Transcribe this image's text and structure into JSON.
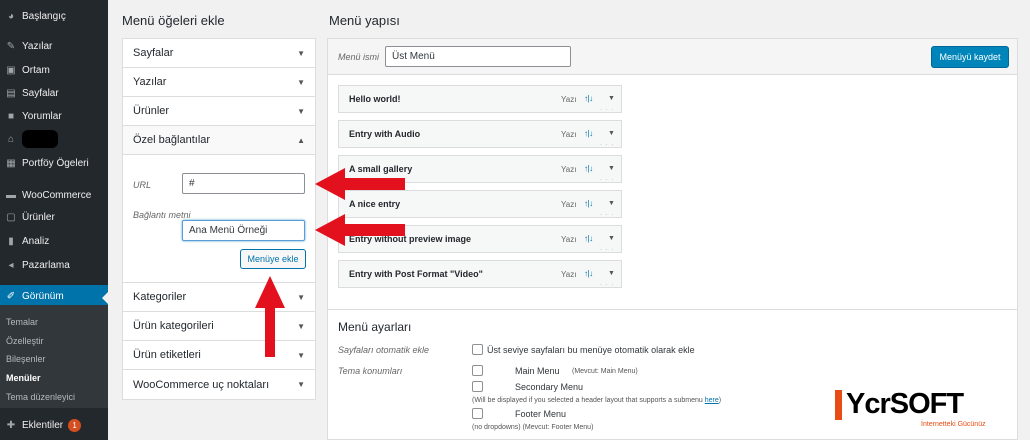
{
  "sidebar": {
    "items": [
      {
        "icon": "dashboard-icon",
        "glyph": "◕",
        "label": "Başlangıç"
      },
      {
        "icon": "pin-icon",
        "glyph": "✎",
        "label": "Yazılar"
      },
      {
        "icon": "media-icon",
        "glyph": "▣",
        "label": "Ortam"
      },
      {
        "icon": "page-icon",
        "glyph": "▤",
        "label": "Sayfalar"
      },
      {
        "icon": "comment-icon",
        "glyph": "■",
        "label": "Yorumlar"
      },
      {
        "icon": "home-icon",
        "glyph": "⌂",
        "label": ""
      },
      {
        "icon": "portfolio-icon",
        "glyph": "▦",
        "label": "Portföy Ögeleri"
      },
      {
        "icon": "woocommerce-icon",
        "glyph": "▬",
        "label": "WooCommerce"
      },
      {
        "icon": "products-icon",
        "glyph": "▢",
        "label": "Ürünler"
      },
      {
        "icon": "analytics-icon",
        "glyph": "▮",
        "label": "Analiz"
      },
      {
        "icon": "marketing-icon",
        "glyph": "◂",
        "label": "Pazarlama"
      },
      {
        "icon": "appearance-icon",
        "glyph": "✐",
        "label": "Görünüm"
      },
      {
        "icon": "plugins-icon",
        "glyph": "✚",
        "label": "Eklentiler"
      }
    ],
    "submenu": [
      "Temalar",
      "Özelleştir",
      "Bileşenler",
      "Menüler",
      "Tema düzenleyici"
    ],
    "plugins_badge": "1"
  },
  "left": {
    "title": "Menü öğeleri ekle",
    "sections_top": [
      "Sayfalar",
      "Yazılar",
      "Ürünler"
    ],
    "custom_links": {
      "title": "Özel bağlantılar",
      "url_label": "URL",
      "url_value": "#",
      "text_label": "Bağlantı metni",
      "text_value": "Ana Menü Örneği",
      "add_button": "Menüye ekle"
    },
    "sections_bottom": [
      "Kategoriler",
      "Ürün kategorileri",
      "Ürün etiketleri",
      "WooCommerce uç noktaları"
    ]
  },
  "right": {
    "title": "Menü yapısı",
    "menu_name_label": "Menü ismi",
    "menu_name_value": "Üst Menü",
    "save_button": "Menüyü kaydet",
    "items": [
      {
        "title": "Hello world!",
        "type": "Yazı"
      },
      {
        "title": "Entry with Audio",
        "type": "Yazı"
      },
      {
        "title": "A small gallery",
        "type": "Yazı"
      },
      {
        "title": "A nice entry",
        "type": "Yazı"
      },
      {
        "title": "Entry without preview image",
        "type": "Yazı"
      },
      {
        "title": "Entry with Post Format \"Video\"",
        "type": "Yazı"
      }
    ],
    "move_links": "↑|↓",
    "settings": {
      "title": "Menü ayarları",
      "auto_add_label": "Sayfaları otomatik ekle",
      "auto_add_text": "Üst seviye sayfaları bu menüye otomatik olarak ekle",
      "locations_label": "Tema konumları",
      "locations": [
        {
          "name": "Main Menu",
          "note": "(Mevcut: Main Menu)"
        },
        {
          "name": "Secondary Menu",
          "note": ""
        },
        {
          "name": "Footer Menu",
          "note": "(Mevcut: Footer Menu)"
        }
      ],
      "secondary_help": "(Will be displayed if you selected a header layout that supports a submenu",
      "secondary_help_link": "here",
      "secondary_help_end": ")",
      "footer_help": "(no dropdowns)"
    }
  },
  "brand": {
    "logo_text": "YcrSOFT",
    "logo_sub": "İnternetteki Gücünüz",
    "accent": "#e74c14"
  },
  "colors": {
    "sidebar_bg": "#23282d",
    "active_bg": "#0073aa",
    "primary_button": "#0085ba",
    "annotation_arrow": "#e3101d"
  }
}
